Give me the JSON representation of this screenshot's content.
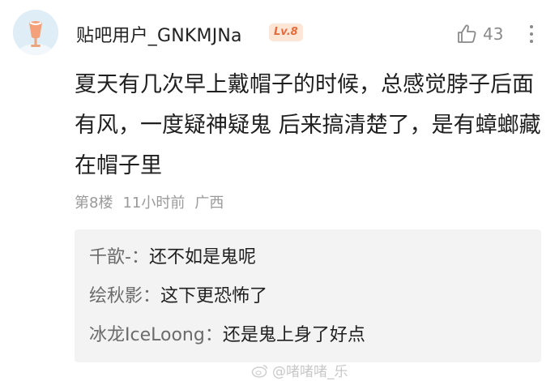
{
  "post": {
    "username": "贴吧用户_GNKMJNa",
    "level_badge": "Lv.8",
    "like_count": "43",
    "content": "夏天有几次早上戴帽子的时候，总感觉脖子后面有风，一度疑神疑鬼 后来搞清楚了，是有蟑螂藏在帽子里",
    "floor": "第8楼",
    "time": "11小时前",
    "location": "广西"
  },
  "replies": [
    {
      "name": "千歆-",
      "sep": "：",
      "text": "还不如是鬼呢"
    },
    {
      "name": "绘秋影",
      "sep": "：",
      "text": "这下更恐怖了"
    },
    {
      "name": "冰龙IceLoong",
      "sep": "：",
      "text": "还是鬼上身了好点"
    }
  ],
  "watermark": {
    "text": "@啫啫啫_乐"
  },
  "colors": {
    "badge_bg": "#fde6d6",
    "badge_text": "#e36b3c",
    "reply_bg": "#f3f3f3",
    "muted": "#9a9a9a"
  },
  "icons": [
    "avatar",
    "thumbs-up-icon",
    "more-vertical-icon",
    "weibo-icon"
  ]
}
